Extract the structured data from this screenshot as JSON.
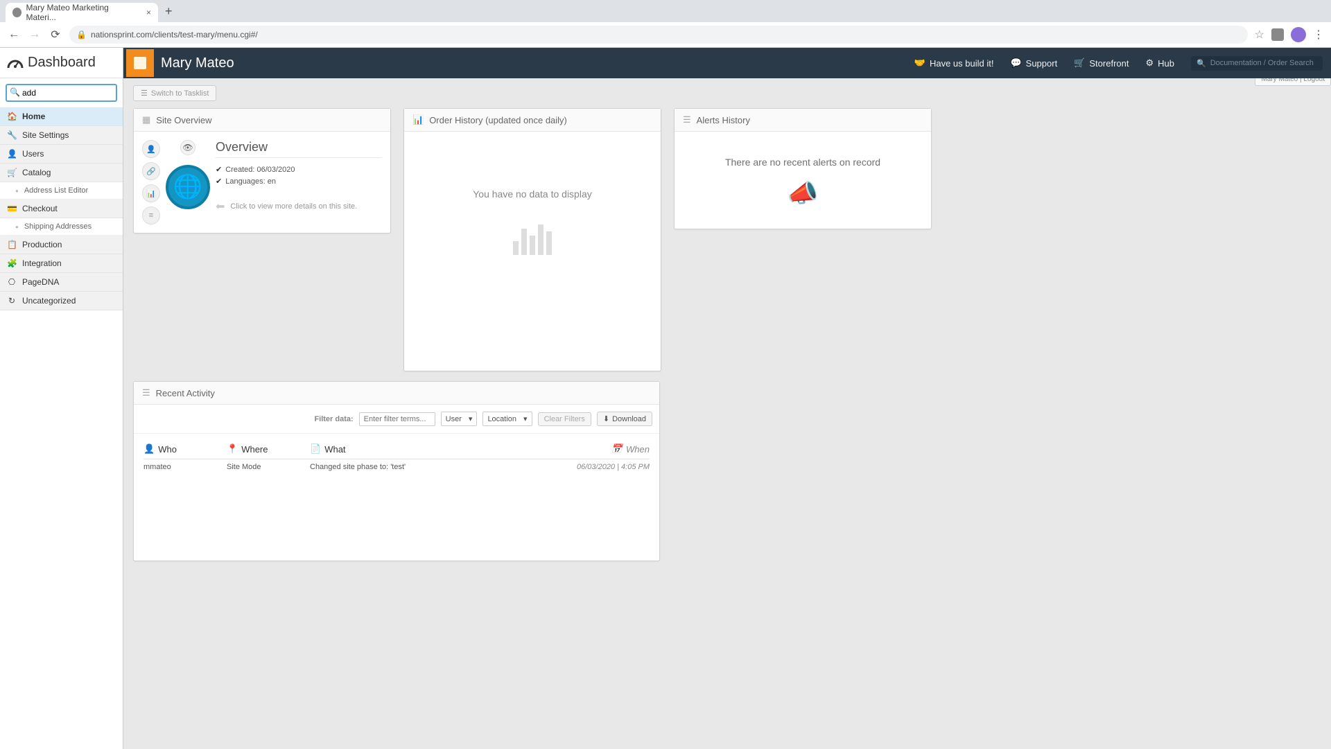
{
  "browser": {
    "tab_title": "Mary Mateo Marketing Materi...",
    "url": "nationsprint.com/clients/test-mary/menu.cgi#/"
  },
  "appbar": {
    "client_name": "Mary Mateo",
    "actions": {
      "build": "Have us build it!",
      "support": "Support",
      "storefront": "Storefront",
      "hub": "Hub"
    },
    "search_placeholder": "Documentation / Order Search"
  },
  "userbadge": "Mary Mateo | Logout",
  "sidebar": {
    "title": "Dashboard",
    "search_value": "add",
    "items": [
      {
        "label": "Home",
        "icon": "home",
        "active": true
      },
      {
        "label": "Site Settings",
        "icon": "wrench"
      },
      {
        "label": "Users",
        "icon": "user"
      },
      {
        "label": "Catalog",
        "icon": "cart"
      }
    ],
    "catalog_sub": {
      "label": "Address List Editor"
    },
    "items2": [
      {
        "label": "Checkout",
        "icon": "card"
      }
    ],
    "checkout_sub": {
      "label": "Shipping Addresses"
    },
    "items3": [
      {
        "label": "Production",
        "icon": "clipboard"
      },
      {
        "label": "Integration",
        "icon": "puzzle"
      },
      {
        "label": "PageDNA",
        "icon": "dna"
      },
      {
        "label": "Uncategorized",
        "icon": "refresh"
      }
    ]
  },
  "toolbar": {
    "switch_label": "Switch to Tasklist"
  },
  "panels": {
    "site_overview": {
      "title": "Site Overview",
      "overview_heading": "Overview",
      "created_label": "Created: 06/03/2020",
      "languages_label": "Languages: en",
      "footer": "Click to view more details on this site."
    },
    "order_history": {
      "title": "Order History (updated once daily)",
      "empty": "You have no data to display"
    },
    "alerts": {
      "title": "Alerts History",
      "empty": "There are no recent alerts on record"
    },
    "recent_activity": {
      "title": "Recent Activity",
      "filter_label": "Filter data:",
      "filter_placeholder": "Enter filter terms...",
      "user_label": "User",
      "location_label": "Location",
      "clear_label": "Clear Filters",
      "download_label": "Download",
      "columns": {
        "who": "Who",
        "where": "Where",
        "what": "What",
        "when": "When"
      },
      "rows": [
        {
          "who": "mmateo",
          "where": "Site Mode",
          "what": "Changed site phase to: 'test'",
          "when": "06/03/2020 | 4:05 PM"
        }
      ]
    }
  }
}
